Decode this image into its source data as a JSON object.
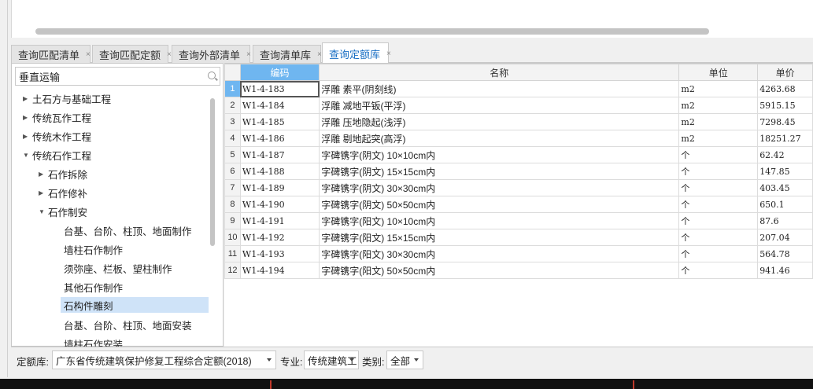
{
  "tabs": [
    {
      "label": "查询匹配清单",
      "active": false
    },
    {
      "label": "查询匹配定额",
      "active": false
    },
    {
      "label": "查询外部清单",
      "active": false
    },
    {
      "label": "查询清单库",
      "active": false
    },
    {
      "label": "查询定额库",
      "active": true
    }
  ],
  "tab_close_glyph": "×",
  "search": {
    "value": "垂直运输"
  },
  "tree": [
    {
      "label": "土石方与基础工程",
      "arrow": "▶",
      "level": 0
    },
    {
      "label": "传统瓦作工程",
      "arrow": "▶",
      "level": 0
    },
    {
      "label": "传统木作工程",
      "arrow": "▶",
      "level": 0
    },
    {
      "label": "传统石作工程",
      "arrow": "▼",
      "level": 0
    },
    {
      "label": "石作拆除",
      "arrow": "▶",
      "level": 1
    },
    {
      "label": "石作修补",
      "arrow": "▶",
      "level": 1
    },
    {
      "label": "石作制安",
      "arrow": "▼",
      "level": 1
    },
    {
      "label": "台基、台阶、柱顶、地面制作",
      "arrow": "",
      "level": 2
    },
    {
      "label": "墙柱石作制作",
      "arrow": "",
      "level": 2
    },
    {
      "label": "须弥座、栏板、望柱制作",
      "arrow": "",
      "level": 2
    },
    {
      "label": "其他石作制作",
      "arrow": "",
      "level": 2
    },
    {
      "label": "石构件雕刻",
      "arrow": "",
      "level": 2,
      "selected": true
    },
    {
      "label": "台基、台阶、柱顶、地面安装",
      "arrow": "",
      "level": 2
    },
    {
      "label": "墙柱石作安装",
      "arrow": "",
      "level": 2
    }
  ],
  "grid": {
    "headers": {
      "code": "编码",
      "name": "名称",
      "unit": "单位",
      "price": "单价"
    },
    "rows": [
      {
        "n": "1",
        "code": "W1-4-183",
        "name": "浮雕 素平(阴刻线)",
        "unit": "m2",
        "price": "4263.68"
      },
      {
        "n": "2",
        "code": "W1-4-184",
        "name": "浮雕 减地平钣(平浮)",
        "unit": "m2",
        "price": "5915.15"
      },
      {
        "n": "3",
        "code": "W1-4-185",
        "name": "浮雕 压地隐起(浅浮)",
        "unit": "m2",
        "price": "7298.45"
      },
      {
        "n": "4",
        "code": "W1-4-186",
        "name": "浮雕 剔地起突(高浮)",
        "unit": "m2",
        "price": "18251.27"
      },
      {
        "n": "5",
        "code": "W1-4-187",
        "name": "字碑镌字(阴文) 10×10cm内",
        "unit": "个",
        "price": "62.42"
      },
      {
        "n": "6",
        "code": "W1-4-188",
        "name": "字碑镌字(阴文) 15×15cm内",
        "unit": "个",
        "price": "147.85"
      },
      {
        "n": "7",
        "code": "W1-4-189",
        "name": "字碑镌字(阴文) 30×30cm内",
        "unit": "个",
        "price": "403.45"
      },
      {
        "n": "8",
        "code": "W1-4-190",
        "name": "字碑镌字(阴文) 50×50cm内",
        "unit": "个",
        "price": "650.1"
      },
      {
        "n": "9",
        "code": "W1-4-191",
        "name": "字碑镌字(阳文) 10×10cm内",
        "unit": "个",
        "price": "87.6"
      },
      {
        "n": "10",
        "code": "W1-4-192",
        "name": "字碑镌字(阳文) 15×15cm内",
        "unit": "个",
        "price": "207.04"
      },
      {
        "n": "11",
        "code": "W1-4-193",
        "name": "字碑镌字(阳文) 30×30cm内",
        "unit": "个",
        "price": "564.78"
      },
      {
        "n": "12",
        "code": "W1-4-194",
        "name": "字碑镌字(阳文) 50×50cm内",
        "unit": "个",
        "price": "941.46"
      }
    ]
  },
  "filter": {
    "quota_label": "定额库:",
    "quota_value": "广东省传统建筑保护修复工程综合定额(2018)",
    "specialty_label": "专业:",
    "specialty_value": "传统建筑工",
    "category_label": "类别:",
    "category_value": "全部"
  },
  "colors": {
    "active_tab_text": "#1a6fc4",
    "selected_header": "#6fb6f0",
    "selected_tree_item": "#cfe3f8"
  }
}
